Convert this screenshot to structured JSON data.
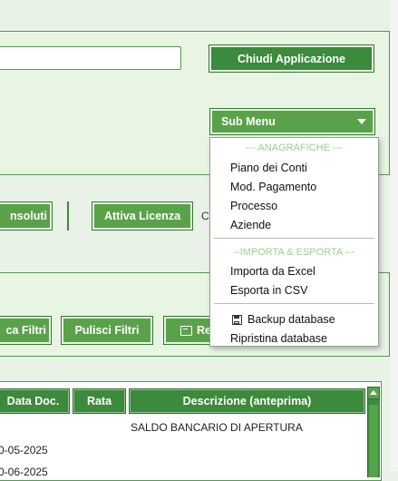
{
  "toolbar": {
    "close_label": "Chiudi Applicazione",
    "search_value": ""
  },
  "actions": {
    "insoluti_label": "nsoluti",
    "license_label": "Attiva Licenza",
    "cut_text": "C"
  },
  "filters": {
    "apply_label": "ca Filtri",
    "clear_label": "Pulisci Filtri",
    "report_label": "Re"
  },
  "submenu": {
    "label": "Sub Menu",
    "groups": [
      {
        "header": "--- ANAGRAFICHE ---",
        "items": [
          "Piano dei Conti",
          "Mod. Pagamento",
          "Processo",
          "Aziende"
        ]
      },
      {
        "header": "--IMPORTA & ESPORTA ---",
        "items": [
          "Importa da Excel",
          "Esporta in CSV"
        ]
      }
    ],
    "extra_items": [
      "Backup database",
      "Ripristina database"
    ]
  },
  "table": {
    "columns": [
      "Data Doc.",
      "Rata",
      "Descrizione (anteprima)"
    ],
    "rows": [
      {
        "date": "",
        "rata": "",
        "desc": "SALDO BANCARIO DI APERTURA"
      },
      {
        "date": "0-05-2025",
        "rata": "",
        "desc": ""
      },
      {
        "date": "0-06-2025",
        "rata": "",
        "desc": ""
      }
    ]
  },
  "icons": {
    "backup": "floppy-disk-icon",
    "report": "report-icon"
  },
  "colors": {
    "accent": "#3c8a3c",
    "button": "#5aa24a",
    "panel_bg": "#e8f5e3",
    "menu_header": "#9bcf8f"
  }
}
